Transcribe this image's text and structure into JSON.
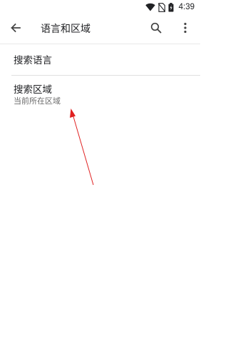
{
  "status_bar": {
    "time": "4:39",
    "icons": [
      "wifi-icon",
      "no-sim-icon",
      "battery-icon"
    ]
  },
  "app_bar": {
    "title": "语言和区域",
    "back_icon": "arrow-back-icon",
    "search_icon": "search-icon",
    "more_icon": "more-vert-icon"
  },
  "preferences": [
    {
      "title": "搜索语言",
      "summary": ""
    },
    {
      "title": "搜索区域",
      "summary": "当前所在区域"
    }
  ],
  "colors": {
    "text_primary": "#202124",
    "text_secondary": "#6b6b6b",
    "divider": "#e0e0e0",
    "annotation_arrow": "#e02020"
  }
}
